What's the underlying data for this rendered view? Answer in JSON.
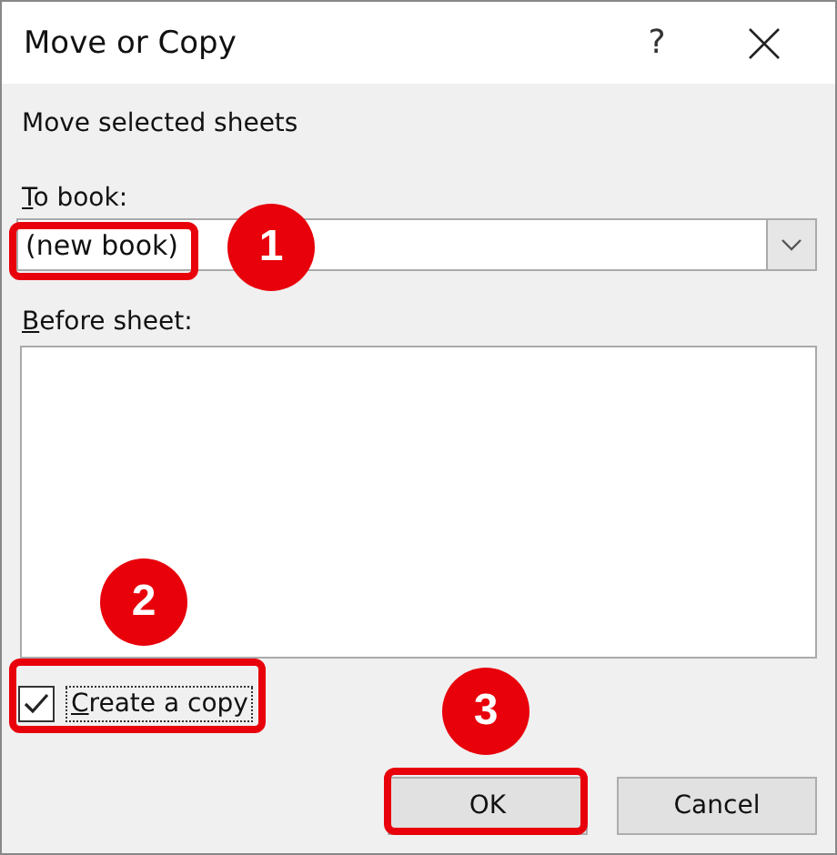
{
  "window": {
    "title": "Move or Copy",
    "help": "?"
  },
  "instruction": "Move selected sheets",
  "to_book": {
    "label": "To book:",
    "value": "(new book)"
  },
  "before_sheet": {
    "label": "Before sheet:"
  },
  "create_copy": {
    "label": "Create a copy",
    "checked": true,
    "focused": true
  },
  "buttons": [
    {
      "label": "OK"
    },
    {
      "label": "Cancel"
    }
  ],
  "callouts": [
    {
      "number": "1"
    },
    {
      "number": "2"
    },
    {
      "number": "3"
    }
  ]
}
